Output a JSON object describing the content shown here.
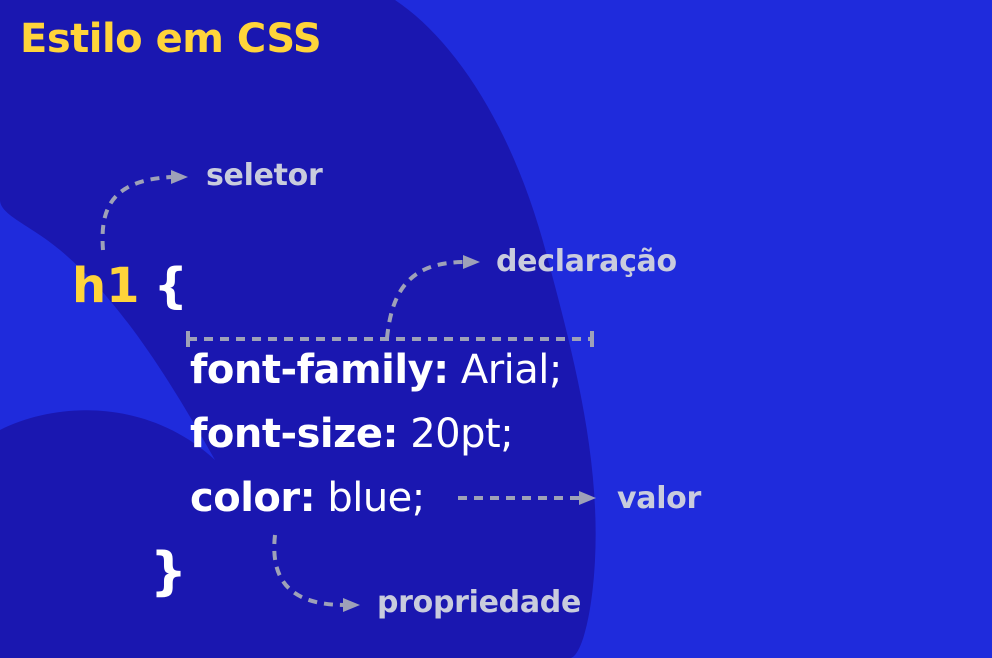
{
  "title": "Estilo em CSS",
  "code": {
    "selector": "h1",
    "open_brace": "{",
    "close_brace": "}",
    "declarations": [
      {
        "property": "font-family:",
        "value": " Arial;"
      },
      {
        "property": "font-size:",
        "value": " 20pt;"
      },
      {
        "property": "color:",
        "value": " blue;"
      }
    ]
  },
  "labels": {
    "seletor": "seletor",
    "declaracao": "declaração",
    "valor": "valor",
    "propriedade": "propriedade"
  },
  "colors": {
    "background": "#1f2bdc",
    "blob": "#1a17b0",
    "accent_yellow": "#ffd43a",
    "annotation_gray": "#9ea1b8",
    "text_white": "#ffffff"
  }
}
